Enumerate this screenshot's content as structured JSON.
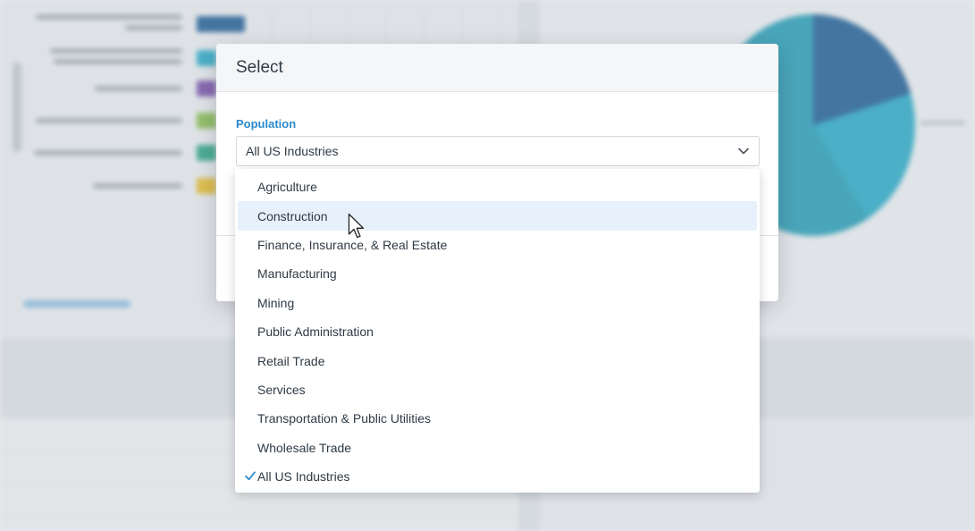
{
  "modal": {
    "title": "Select",
    "field_label": "Population",
    "selected_value": "All US Industries",
    "dropdown_icon": "chevron-down-icon"
  },
  "dropdown": {
    "hovered_item": "Construction",
    "checked_item": "All US Industries",
    "check_icon": "checkmark-icon",
    "options": [
      "Agriculture",
      "Construction",
      "Finance, Insurance, & Real Estate",
      "Manufacturing",
      "Mining",
      "Public Administration",
      "Retail Trade",
      "Services",
      "Transportation & Public Utilities",
      "Wholesale Trade",
      "All US Industries"
    ]
  },
  "colors": {
    "accent": "#2b8acb",
    "hover_bg": "#e7f1fc",
    "text": "#2f3a45",
    "bar_colors": [
      "#0d4f8a",
      "#18a0bf",
      "#6b3fa0",
      "#7cb342",
      "#1a9a7a",
      "#e0b31c"
    ],
    "pie_colors": [
      "#0d4f8a",
      "#18a0bf",
      "#1592ad"
    ]
  }
}
